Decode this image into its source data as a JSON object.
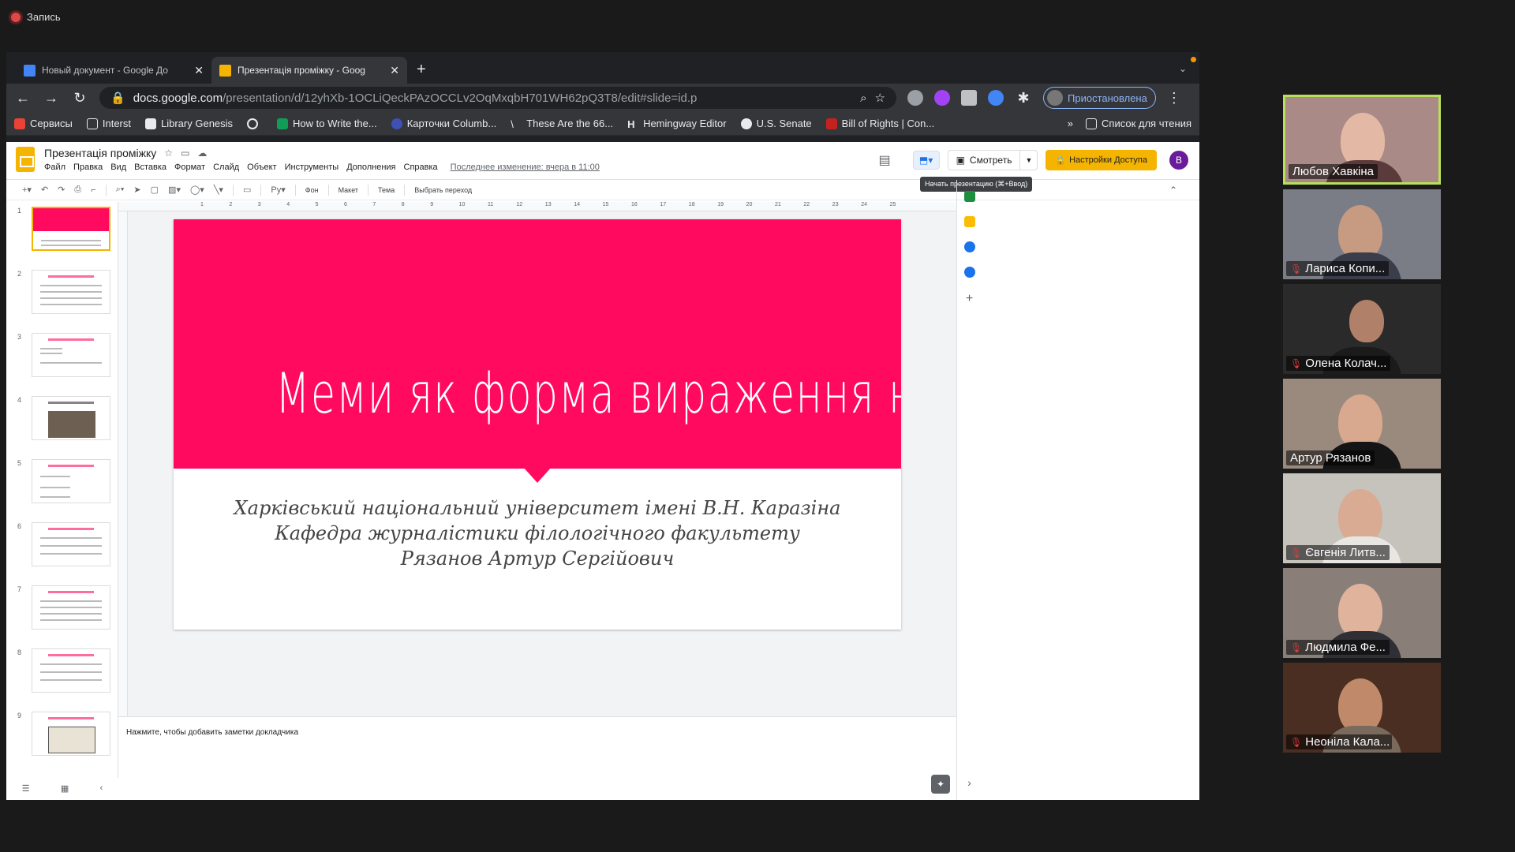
{
  "recording": {
    "label": "Запись"
  },
  "browser": {
    "tabs": [
      {
        "title": "Новый документ - Google До",
        "type": "doc",
        "active": false
      },
      {
        "title": "Презентація проміжку - Goog",
        "type": "slides",
        "active": true
      }
    ],
    "url_host": "docs.google.com",
    "url_path": "/presentation/d/12yhXb-1OCLiQeckPAzOCCLv2OqMxqbH701WH62pQ3T8/edit#slide=id.p",
    "profile_label": "Приостановлена",
    "bookmarks": [
      "Сервисы",
      "Interst",
      "Library Genesis",
      "",
      "How to Write the...",
      "Карточки Columb...",
      "These Are the 66...",
      "Hemingway Editor",
      "U.S. Senate",
      "Bill of Rights | Con..."
    ],
    "bookmarks_more": "»",
    "reading_list": "Список для чтения"
  },
  "app": {
    "doc_title": "Презентація проміжку",
    "menu": [
      "Файл",
      "Правка",
      "Вид",
      "Вставка",
      "Формат",
      "Слайд",
      "Объект",
      "Инструменты",
      "Дополнения",
      "Справка"
    ],
    "last_edit": "Последнее изменение: вчера в 11:00",
    "watch_label": "Смотреть",
    "share_label": "Настройки Доступа",
    "user_initial": "В",
    "tooltip": "Начать презентацию (⌘+Ввод)",
    "toolbar": {
      "bg": "Фон",
      "layout": "Макет",
      "theme": "Тема",
      "transition": "Выбрать переход"
    },
    "slide_numbers": [
      "1",
      "2",
      "3",
      "4",
      "5",
      "6",
      "7",
      "8",
      "9"
    ],
    "ruler_ticks": [
      "1",
      "2",
      "3",
      "4",
      "5",
      "6",
      "7",
      "8",
      "9",
      "10",
      "11",
      "12",
      "13",
      "14",
      "15",
      "16",
      "17",
      "18",
      "19",
      "20",
      "21",
      "22",
      "23",
      "24",
      "25"
    ],
    "slide": {
      "title": "Меми як форма вираження новин",
      "subtitle": [
        "Харківський національний університет імені В.Н. Каразіна",
        "Кафедра журналістики філологічного факультету",
        "Рязанов Артур Сергійович"
      ],
      "accent": "#ff0a5f"
    },
    "notes_placeholder": "Нажмите, чтобы добавить заметки докладчика"
  },
  "participants": [
    {
      "name": "Любов Хавкіна",
      "muted": false,
      "active": true
    },
    {
      "name": "Лариса Копи...",
      "muted": true,
      "active": false
    },
    {
      "name": "Олена Колач...",
      "muted": true,
      "active": false
    },
    {
      "name": "Артур Рязанов",
      "muted": false,
      "active": false
    },
    {
      "name": "Євгенія Литв...",
      "muted": true,
      "active": false
    },
    {
      "name": "Людмила Фе...",
      "muted": true,
      "active": false
    },
    {
      "name": "Неоніла Кала...",
      "muted": true,
      "active": false
    }
  ]
}
